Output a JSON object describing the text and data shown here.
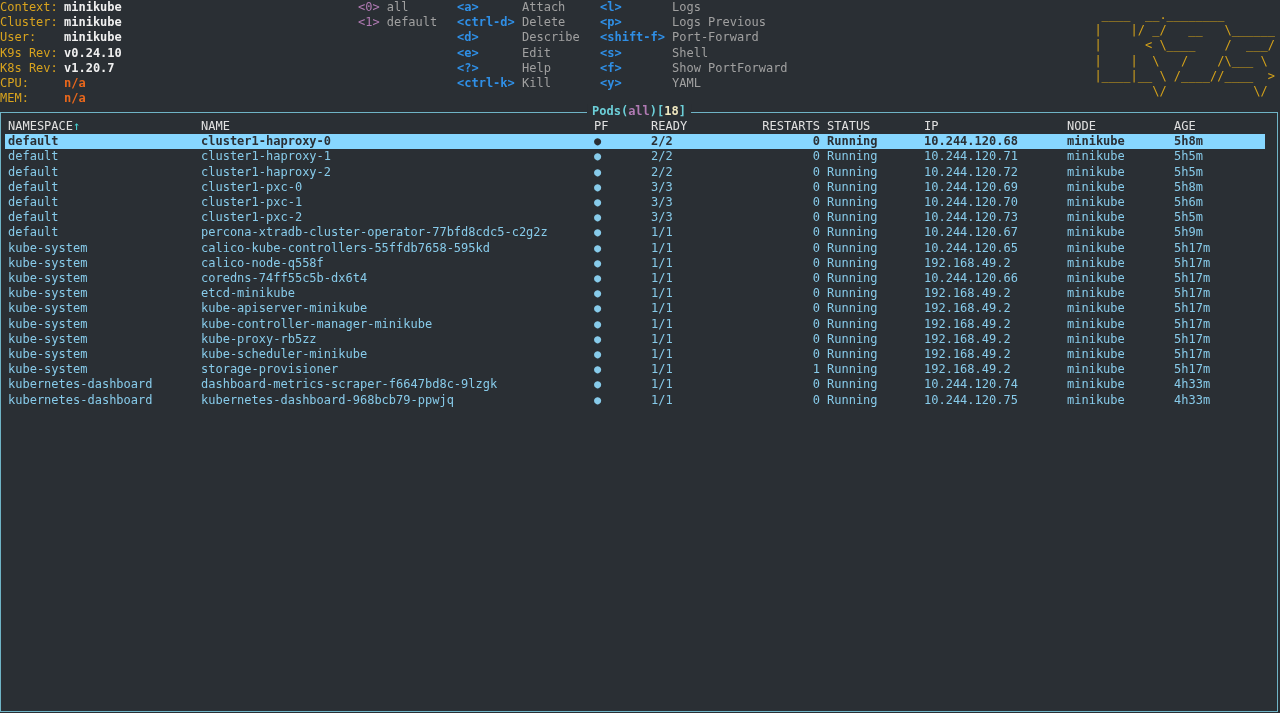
{
  "cluster_info": [
    {
      "label": "Context:",
      "value": "minikube",
      "kind": "plain"
    },
    {
      "label": "Cluster:",
      "value": "minikube",
      "kind": "plain"
    },
    {
      "label": "User:",
      "value": "minikube",
      "kind": "plain"
    },
    {
      "label": "K9s Rev:",
      "value": "v0.24.10",
      "kind": "plain"
    },
    {
      "label": "K8s Rev:",
      "value": "v1.20.7",
      "kind": "plain"
    },
    {
      "label": "CPU:",
      "value": "n/a",
      "kind": "metric"
    },
    {
      "label": "MEM:",
      "value": "n/a",
      "kind": "metric"
    }
  ],
  "namespaces": [
    {
      "key": "<0>",
      "label": "all"
    },
    {
      "key": "<1>",
      "label": "default"
    }
  ],
  "shortcuts": [
    [
      {
        "key": "<a>",
        "label": "Attach"
      },
      {
        "key": "<ctrl-d>",
        "label": "Delete"
      },
      {
        "key": "<d>",
        "label": "Describe"
      },
      {
        "key": "<e>",
        "label": "Edit"
      },
      {
        "key": "<?>",
        "label": "Help"
      },
      {
        "key": "<ctrl-k>",
        "label": "Kill"
      }
    ],
    [
      {
        "key": "<l>",
        "label": "Logs"
      },
      {
        "key": "<p>",
        "label": "Logs Previous"
      },
      {
        "key": "<shift-f>",
        "label": "Port-Forward"
      },
      {
        "key": "<s>",
        "label": "Shell"
      },
      {
        "key": "<f>",
        "label": "Show PortForward"
      },
      {
        "key": "<y>",
        "label": "YAML"
      }
    ]
  ],
  "logo": [
    " ____  __.________       ",
    "|    |/ _/   __   \\______",
    "|      < \\____    /  ___/",
    "|    |  \\   /    /\\___ \\ ",
    "|____|__ \\ /____//____  >",
    "        \\/            \\/ "
  ],
  "panel": {
    "title_parts": [
      {
        "text": "Pods",
        "kind": "resource"
      },
      {
        "text": "(",
        "kind": "punct"
      },
      {
        "text": "all",
        "kind": "scope"
      },
      {
        "text": ")",
        "kind": "punct"
      },
      {
        "text": "[",
        "kind": "punct"
      },
      {
        "text": "18",
        "kind": "count"
      },
      {
        "text": "]",
        "kind": "punct"
      }
    ]
  },
  "table": {
    "columns": [
      {
        "label": "NAMESPACE",
        "sort_indicator": "↑"
      },
      {
        "label": "NAME"
      },
      {
        "label": "PF"
      },
      {
        "label": "READY"
      },
      {
        "label": "RESTARTS"
      },
      {
        "label": "STATUS"
      },
      {
        "label": "IP"
      },
      {
        "label": "NODE"
      },
      {
        "label": "AGE"
      }
    ],
    "rows": [
      {
        "selected": true,
        "cells": [
          "default",
          "cluster1-haproxy-0",
          "●",
          "2/2",
          "0",
          "Running",
          "10.244.120.68",
          "minikube",
          "5h8m"
        ]
      },
      {
        "selected": false,
        "cells": [
          "default",
          "cluster1-haproxy-1",
          "●",
          "2/2",
          "0",
          "Running",
          "10.244.120.71",
          "minikube",
          "5h5m"
        ]
      },
      {
        "selected": false,
        "cells": [
          "default",
          "cluster1-haproxy-2",
          "●",
          "2/2",
          "0",
          "Running",
          "10.244.120.72",
          "minikube",
          "5h5m"
        ]
      },
      {
        "selected": false,
        "cells": [
          "default",
          "cluster1-pxc-0",
          "●",
          "3/3",
          "0",
          "Running",
          "10.244.120.69",
          "minikube",
          "5h8m"
        ]
      },
      {
        "selected": false,
        "cells": [
          "default",
          "cluster1-pxc-1",
          "●",
          "3/3",
          "0",
          "Running",
          "10.244.120.70",
          "minikube",
          "5h6m"
        ]
      },
      {
        "selected": false,
        "cells": [
          "default",
          "cluster1-pxc-2",
          "●",
          "3/3",
          "0",
          "Running",
          "10.244.120.73",
          "minikube",
          "5h5m"
        ]
      },
      {
        "selected": false,
        "cells": [
          "default",
          "percona-xtradb-cluster-operator-77bfd8cdc5-c2g2z",
          "●",
          "1/1",
          "0",
          "Running",
          "10.244.120.67",
          "minikube",
          "5h9m"
        ]
      },
      {
        "selected": false,
        "cells": [
          "kube-system",
          "calico-kube-controllers-55ffdb7658-595kd",
          "●",
          "1/1",
          "0",
          "Running",
          "10.244.120.65",
          "minikube",
          "5h17m"
        ]
      },
      {
        "selected": false,
        "cells": [
          "kube-system",
          "calico-node-q558f",
          "●",
          "1/1",
          "0",
          "Running",
          "192.168.49.2",
          "minikube",
          "5h17m"
        ]
      },
      {
        "selected": false,
        "cells": [
          "kube-system",
          "coredns-74ff55c5b-dx6t4",
          "●",
          "1/1",
          "0",
          "Running",
          "10.244.120.66",
          "minikube",
          "5h17m"
        ]
      },
      {
        "selected": false,
        "cells": [
          "kube-system",
          "etcd-minikube",
          "●",
          "1/1",
          "0",
          "Running",
          "192.168.49.2",
          "minikube",
          "5h17m"
        ]
      },
      {
        "selected": false,
        "cells": [
          "kube-system",
          "kube-apiserver-minikube",
          "●",
          "1/1",
          "0",
          "Running",
          "192.168.49.2",
          "minikube",
          "5h17m"
        ]
      },
      {
        "selected": false,
        "cells": [
          "kube-system",
          "kube-controller-manager-minikube",
          "●",
          "1/1",
          "0",
          "Running",
          "192.168.49.2",
          "minikube",
          "5h17m"
        ]
      },
      {
        "selected": false,
        "cells": [
          "kube-system",
          "kube-proxy-rb5zz",
          "●",
          "1/1",
          "0",
          "Running",
          "192.168.49.2",
          "minikube",
          "5h17m"
        ]
      },
      {
        "selected": false,
        "cells": [
          "kube-system",
          "kube-scheduler-minikube",
          "●",
          "1/1",
          "0",
          "Running",
          "192.168.49.2",
          "minikube",
          "5h17m"
        ]
      },
      {
        "selected": false,
        "cells": [
          "kube-system",
          "storage-provisioner",
          "●",
          "1/1",
          "1",
          "Running",
          "192.168.49.2",
          "minikube",
          "5h17m"
        ]
      },
      {
        "selected": false,
        "cells": [
          "kubernetes-dashboard",
          "dashboard-metrics-scraper-f6647bd8c-9lzgk",
          "●",
          "1/1",
          "0",
          "Running",
          "10.244.120.74",
          "minikube",
          "4h33m"
        ]
      },
      {
        "selected": false,
        "cells": [
          "kubernetes-dashboard",
          "kubernetes-dashboard-968bcb79-ppwjq",
          "●",
          "1/1",
          "0",
          "Running",
          "10.244.120.75",
          "minikube",
          "4h33m"
        ]
      }
    ]
  }
}
